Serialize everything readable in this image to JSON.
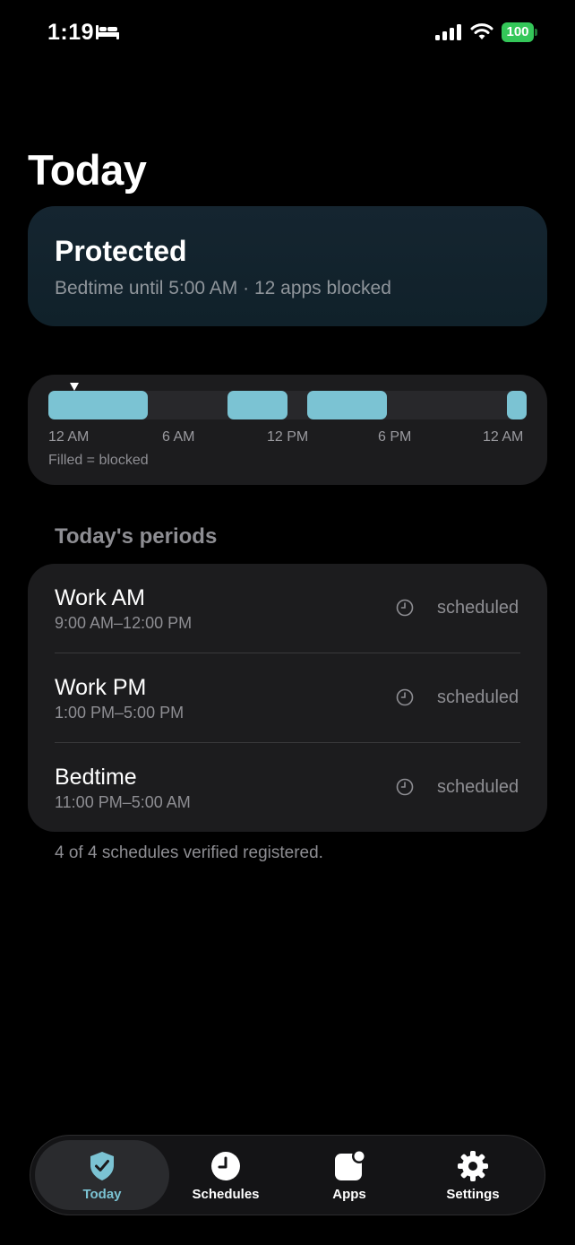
{
  "status_bar": {
    "time": "1:19",
    "battery": "100"
  },
  "page_title": "Today",
  "protected_card": {
    "title": "Protected",
    "subtitle": "Bedtime until 5:00 AM · 12 apps blocked"
  },
  "timeline": {
    "ticks": [
      "12 AM",
      "6 AM",
      "12 PM",
      "6 PM",
      "12 AM"
    ],
    "legend": "Filled = blocked",
    "blocked_hours": [
      {
        "start": 0,
        "end": 5
      },
      {
        "start": 9,
        "end": 12
      },
      {
        "start": 13,
        "end": 17
      },
      {
        "start": 23,
        "end": 24
      }
    ],
    "now_hour": 1.32,
    "block_color": "#7bc3d3"
  },
  "periods_section": {
    "header": "Today's periods",
    "items": [
      {
        "name": "Work AM",
        "time": "9:00 AM–12:00 PM",
        "status": "scheduled"
      },
      {
        "name": "Work PM",
        "time": "1:00 PM–5:00 PM",
        "status": "scheduled"
      },
      {
        "name": "Bedtime",
        "time": "11:00 PM–5:00 AM",
        "status": "scheduled"
      }
    ]
  },
  "footnote": "4 of 4 schedules verified registered.",
  "tab_bar": {
    "tabs": [
      {
        "label": "Today",
        "icon": "shield-check-icon",
        "active": true
      },
      {
        "label": "Schedules",
        "icon": "clock-icon",
        "active": false
      },
      {
        "label": "Apps",
        "icon": "app-badge-icon",
        "active": false
      },
      {
        "label": "Settings",
        "icon": "gear-icon",
        "active": false
      }
    ],
    "accent": "#7bc3d3"
  }
}
